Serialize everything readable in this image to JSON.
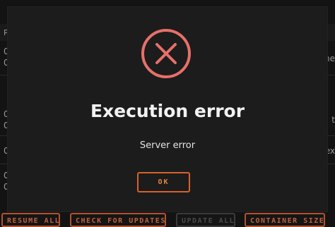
{
  "background": {
    "header_label": "P",
    "rows": [
      {
        "left": "0",
        "right": ""
      },
      {
        "left": "0",
        "right": "ne"
      },
      {
        "left": "0",
        "right": "t"
      },
      {
        "left": "0",
        "right": ""
      },
      {
        "left": "0",
        "right": "ex"
      },
      {
        "left": "0",
        "right": ""
      },
      {
        "left": "0",
        "right": ""
      }
    ],
    "buttons": [
      {
        "label": "RESUME ALL",
        "disabled": false
      },
      {
        "label": "CHECK FOR UPDATES",
        "disabled": false
      },
      {
        "label": "UPDATE ALL",
        "disabled": true
      },
      {
        "label": "CONTAINER SIZE",
        "disabled": false
      }
    ]
  },
  "dialog": {
    "icon": "error-x-circle-icon",
    "title": "Execution error",
    "message": "Server error",
    "ok_label": "OK",
    "colors": {
      "icon": "#e8706a",
      "accent": "#d9612a"
    }
  }
}
